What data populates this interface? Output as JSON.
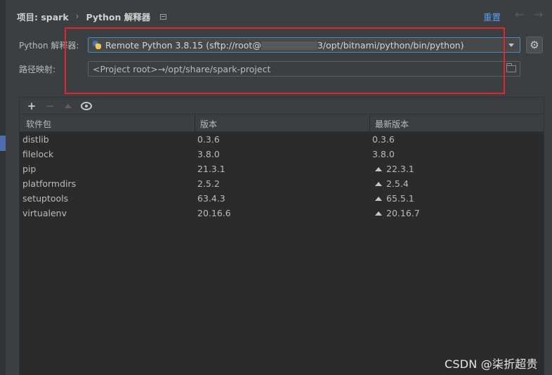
{
  "breadcrumb": {
    "project": "项目: spark",
    "separator": "›",
    "page": "Python 解释器"
  },
  "header": {
    "reset_label": "重置",
    "back_icon": "←",
    "forward_icon": "→"
  },
  "interpreter": {
    "label": "Python 解释器:",
    "value_prefix": "Remote Python 3.8.15 (sftp://root@",
    "value_suffix": "3/opt/bitnami/python/bin/python)",
    "icon": "python-icon"
  },
  "path_mapping": {
    "label": "路径映射:",
    "value": "<Project root>→/opt/share/spark-project"
  },
  "toolbar": {
    "add": "+",
    "remove": "−"
  },
  "table": {
    "columns": [
      "软件包",
      "版本",
      "最新版本"
    ],
    "rows": [
      {
        "name": "distlib",
        "version": "0.3.6",
        "latest": "0.3.6",
        "upgrade": false
      },
      {
        "name": "filelock",
        "version": "3.8.0",
        "latest": "3.8.0",
        "upgrade": false
      },
      {
        "name": "pip",
        "version": "21.3.1",
        "latest": "22.3.1",
        "upgrade": true
      },
      {
        "name": "platformdirs",
        "version": "2.5.2",
        "latest": "2.5.4",
        "upgrade": true
      },
      {
        "name": "setuptools",
        "version": "63.4.3",
        "latest": "65.5.1",
        "upgrade": true
      },
      {
        "name": "virtualenv",
        "version": "20.16.6",
        "latest": "20.16.7",
        "upgrade": true
      }
    ]
  },
  "watermark": "CSDN @柒折超贵",
  "colors": {
    "background": "#3c3f41",
    "table_background": "#2b2b2b",
    "accent": "#589df6",
    "focus_border": "#4a88c7",
    "highlight": "#e0262c"
  }
}
